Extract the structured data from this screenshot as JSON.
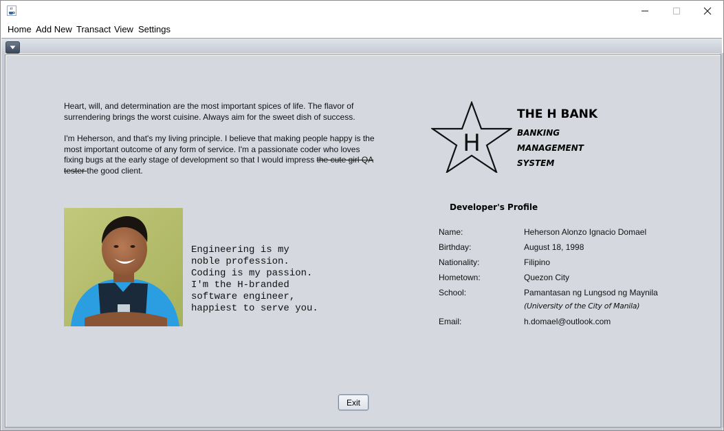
{
  "window": {
    "app_icon": "java-cup-icon",
    "controls": [
      "minimize-icon",
      "maximize-icon",
      "close-icon"
    ]
  },
  "menu": {
    "items": [
      "Home",
      "Add New",
      "Transact",
      "View",
      "Settings"
    ]
  },
  "toolbar": {
    "dropdown_icon": "chevron-down-icon"
  },
  "about": {
    "quote_1": "Heart, will, and determination are the most important spices of life. The flavor of surrendering brings the worst cuisine. Always aim for the sweet dish of success.",
    "quote_2_before": "I'm Heherson, and that's my living principle. I believe that making people happy is the most important outcome of any form of service. I'm a passionate coder who loves fixing bugs at the early stage of development so that I would impress ",
    "quote_2_strike": "the cute girl QA tester ",
    "quote_2_after": "the good client.",
    "motto_lines": [
      "Engineering is my",
      "noble profession.",
      "Coding is my passion.",
      "I'm the H-branded",
      "software engineer,",
      "happiest to serve you."
    ]
  },
  "logo": {
    "letter": "H",
    "title": "THE H BANK",
    "subtitle_lines": [
      "BANKING",
      "MANAGEMENT",
      "SYSTEM"
    ]
  },
  "profile": {
    "heading": "Developer's Profile",
    "fields": [
      {
        "label": "Name:",
        "value": "Heherson Alonzo Ignacio Domael"
      },
      {
        "label": "Birthday:",
        "value": "August 18, 1998"
      },
      {
        "label": "Nationality:",
        "value": "Filipino"
      },
      {
        "label": "Hometown:",
        "value": "Quezon City"
      },
      {
        "label": "School:",
        "value": "Pamantasan ng Lungsod ng Maynila",
        "note": "(University of the City of Manila)"
      },
      {
        "label": "Email:",
        "value": "h.domael@outlook.com"
      }
    ]
  },
  "actions": {
    "exit_label": "Exit"
  },
  "colors": {
    "content_bg": "#d5d8df",
    "shirt_blue": "#2a9ee0",
    "photo_bg": "#b9c070"
  }
}
